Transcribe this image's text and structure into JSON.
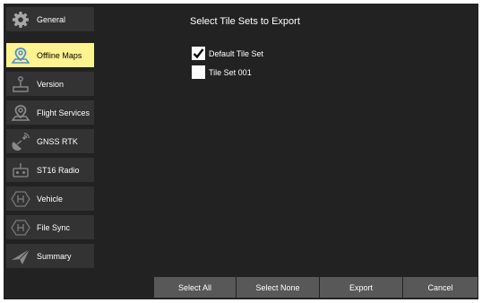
{
  "sidebar": {
    "items": [
      {
        "label": "General",
        "icon": "gear-icon",
        "active": false
      },
      {
        "label": "Offline Maps",
        "icon": "map-pin-icon",
        "active": true
      },
      {
        "label": "Version",
        "icon": "joystick-icon",
        "active": false
      },
      {
        "label": "Flight Services",
        "icon": "map-pin-icon",
        "active": false
      },
      {
        "label": "GNSS RTK",
        "icon": "satellite-icon",
        "active": false
      },
      {
        "label": "ST16 Radio",
        "icon": "controller-icon",
        "active": false
      },
      {
        "label": "Vehicle",
        "icon": "hexagon-h-icon",
        "active": false
      },
      {
        "label": "File Sync",
        "icon": "hexagon-h-icon",
        "active": false
      },
      {
        "label": "Summary",
        "icon": "paper-plane-icon",
        "active": false
      }
    ]
  },
  "main": {
    "title": "Select Tile Sets to Export",
    "tile_sets": [
      {
        "label": "Default Tile Set",
        "checked": true
      },
      {
        "label": "Tile Set 001",
        "checked": false
      }
    ]
  },
  "buttons": {
    "select_all": "Select All",
    "select_none": "Select None",
    "export": "Export",
    "cancel": "Cancel"
  },
  "colors": {
    "background": "#222222",
    "sidebar_button": "#333333",
    "active_button": "#fff291",
    "bottom_button": "#585858"
  }
}
